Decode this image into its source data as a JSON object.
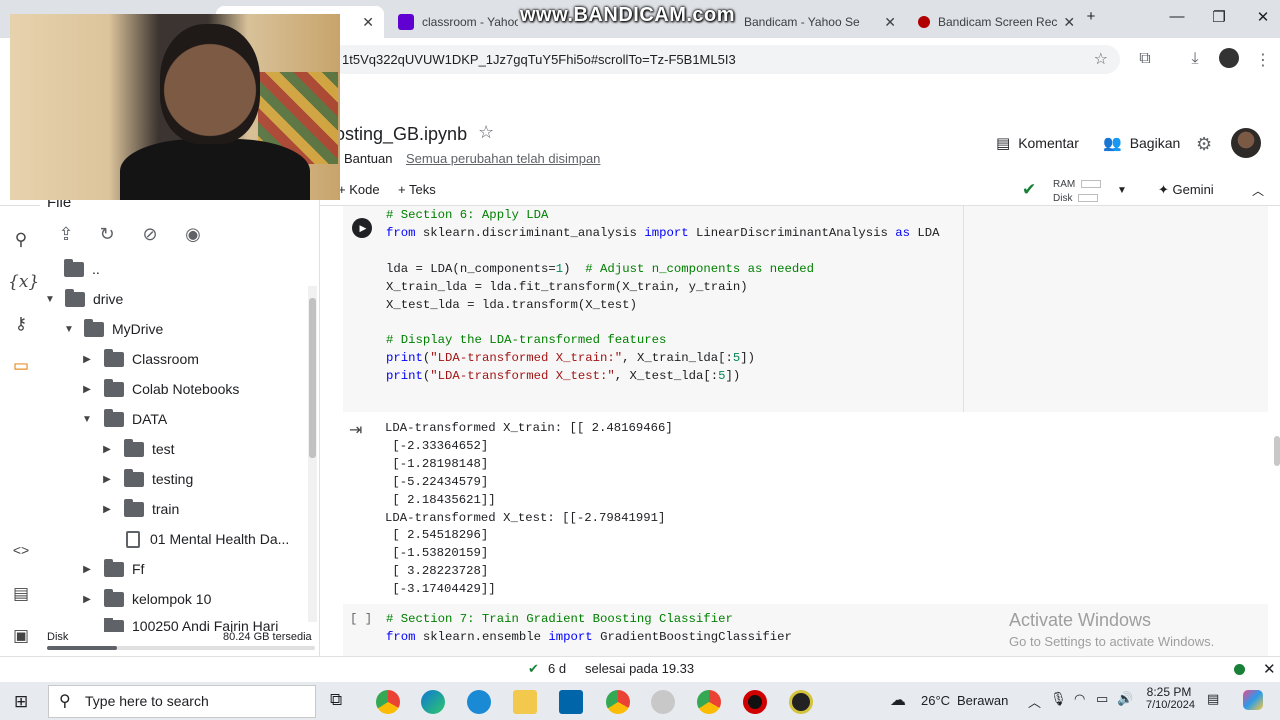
{
  "browser": {
    "tabs": [
      {
        "label": "classroom - Yahoo Se",
        "color": "#6001d2"
      },
      {
        "label": "Bandicam - Yahoo Se",
        "color": "#6001d2"
      },
      {
        "label": "Bandicam Screen Rec",
        "color": "#b00000"
      }
    ],
    "url": "1t5Vq322qUVUW1DKP_1Jz7gqTuY5Fhi5o#scrollTo=Tz-F5B1ML5I3"
  },
  "watermark": "www.BANDICAM.com",
  "colab": {
    "notebook_title": "osting_GB.ipynb",
    "menu_help": "Bantuan",
    "save_status": "Semua perubahan telah disimpan",
    "comment_label": "Komentar",
    "share_label": "Bagikan",
    "add_code_label": "Kode",
    "add_text_label": "Teks",
    "ram_label": "RAM",
    "disk_label": "Disk",
    "gemini_label": "Gemini"
  },
  "file_panel": {
    "title": "File",
    "tree": [
      {
        "label": ".."
      },
      {
        "label": "drive"
      },
      {
        "label": "MyDrive"
      },
      {
        "label": "Classroom"
      },
      {
        "label": "Colab Notebooks"
      },
      {
        "label": "DATA"
      },
      {
        "label": "test"
      },
      {
        "label": "testing"
      },
      {
        "label": "train"
      },
      {
        "label": "01 Mental Health Da..."
      },
      {
        "label": "Ff"
      },
      {
        "label": "kelompok 10"
      },
      {
        "label": "100250 Andi Fajrin Hari"
      }
    ],
    "disk_label": "Disk",
    "disk_free": "80.24 GB tersedia",
    "disk_used_fraction": 0.26
  },
  "cells": {
    "cell6_code": [
      "# Section 6: Apply LDA",
      "from sklearn.discriminant_analysis import LinearDiscriminantAnalysis as LDA",
      "",
      "lda = LDA(n_components=1)  # Adjust n_components as needed",
      "X_train_lda = lda.fit_transform(X_train, y_train)",
      "X_test_lda = lda.transform(X_test)",
      "",
      "# Display the LDA-transformed features",
      "print(\"LDA-transformed X_train:\", X_train_lda[:5])",
      "print(\"LDA-transformed X_test:\", X_test_lda[:5])"
    ],
    "cell6_output": [
      "LDA-transformed X_train: [[ 2.48169466]",
      " [-2.33364652]",
      " [-1.28198148]",
      " [-5.22434579]",
      " [ 2.18435621]]",
      "LDA-transformed X_test: [[-2.79841991]",
      " [ 2.54518296]",
      " [-1.53820159]",
      " [ 3.28223728]",
      " [-3.17404429]]"
    ],
    "cell7_bracket": "[ ]",
    "cell7_code": [
      "# Section 7: Train Gradient Boosting Classifier",
      "from sklearn.ensemble import GradientBoostingClassifier"
    ]
  },
  "activate_windows": {
    "line1": "Activate Windows",
    "line2": "Go to Settings to activate Windows."
  },
  "status_bar": {
    "duration": "6 d",
    "completed": "selesai pada 19.33"
  },
  "taskbar": {
    "search_placeholder": "Type here to search",
    "weather_temp": "26°C",
    "weather_desc": "Berawan",
    "time": "8:25 PM",
    "date": "7/10/2024"
  }
}
